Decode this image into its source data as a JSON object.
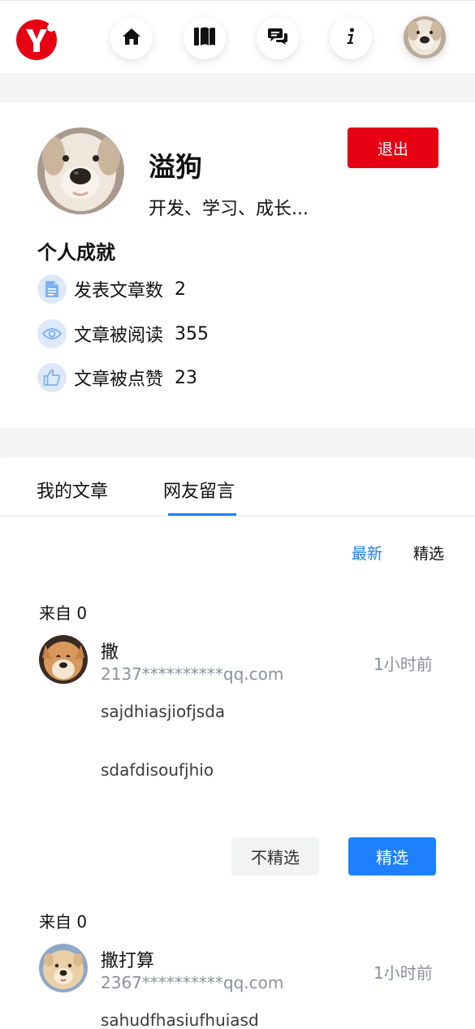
{
  "nav": {
    "logo_icon": "yan-logo-icon",
    "items": [
      {
        "icon": "home-icon"
      },
      {
        "icon": "book-icon"
      },
      {
        "icon": "chat-icon"
      },
      {
        "icon": "info-icon"
      }
    ],
    "avatar": "user-avatar"
  },
  "profile": {
    "username": "溢狗",
    "bio": "开发、学习、成长...",
    "logout_label": "退出",
    "achievements_title": "个人成就",
    "stats": [
      {
        "icon": "document-icon",
        "label": "发表文章数",
        "value": "2"
      },
      {
        "icon": "eye-icon",
        "label": "文章被阅读",
        "value": "355"
      },
      {
        "icon": "thumbs-up-icon",
        "label": "文章被点赞",
        "value": "23"
      }
    ]
  },
  "tabs": {
    "items": [
      {
        "label": "我的文章"
      },
      {
        "label": "网友留言"
      }
    ],
    "active_index": 1
  },
  "filters": {
    "latest": "最新",
    "featured": "精选"
  },
  "comments": [
    {
      "from": "来自 0",
      "name": "撒",
      "email": "2137**********qq.com",
      "time": "1小时前",
      "lines": [
        "sajdhiasjiofjsda",
        "sdafdisoufjhio"
      ],
      "unfeature_label": "不精选",
      "feature_label": "精选"
    },
    {
      "from": "来自 0",
      "name": "撒打算",
      "email": "2367**********qq.com",
      "time": "1小时前",
      "lines": [
        "sahudfhasiufhuiasd"
      ]
    }
  ],
  "colors": {
    "brand_red": "#e60012",
    "accent_blue": "#1e80ff",
    "muted_text": "#8a919f"
  }
}
